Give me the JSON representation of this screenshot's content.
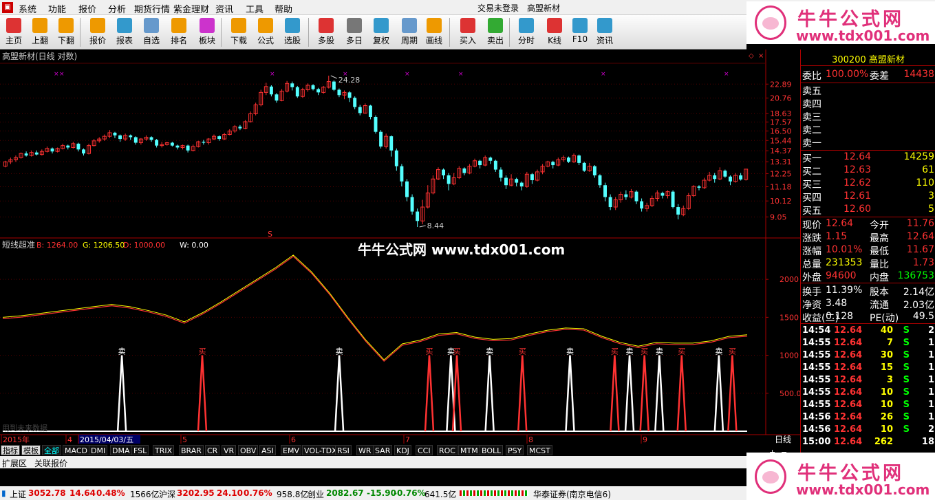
{
  "menubar": {
    "items": [
      "系统",
      "功能",
      "报价",
      "分析",
      "期货行情",
      "紫金理财",
      "资讯",
      "工具",
      "帮助"
    ],
    "center": [
      "交易未登录",
      "高盟新材"
    ]
  },
  "toolbar": [
    {
      "label": "主页",
      "icon": "home-icon",
      "color": "#d33"
    },
    {
      "label": "上翻",
      "icon": "arrow-up-icon",
      "color": "#e90"
    },
    {
      "label": "下翻",
      "icon": "arrow-down-icon",
      "color": "#e90"
    },
    {
      "label": "报价",
      "icon": "yuan-icon",
      "color": "#e90"
    },
    {
      "label": "报表",
      "icon": "report-icon",
      "color": "#39c"
    },
    {
      "label": "自选",
      "icon": "f6-icon",
      "color": "#69c"
    },
    {
      "label": "排名",
      "icon": "rank-icon",
      "color": "#e90"
    },
    {
      "label": "板块",
      "icon": "sector-icon",
      "color": "#c3c"
    },
    {
      "label": "下载",
      "icon": "download-icon",
      "color": "#e90"
    },
    {
      "label": "公式",
      "icon": "formula-icon",
      "color": "#e90"
    },
    {
      "label": "选股",
      "icon": "select-stock-icon",
      "color": "#39c"
    },
    {
      "label": "多股",
      "icon": "multi-stock-icon",
      "color": "#d33"
    },
    {
      "label": "多日",
      "icon": "clock-icon",
      "color": "#777"
    },
    {
      "label": "复权",
      "icon": "restore-icon",
      "color": "#39c"
    },
    {
      "label": "周期",
      "icon": "f8-icon",
      "color": "#69c"
    },
    {
      "label": "画线",
      "icon": "draw-line-icon",
      "color": "#e90"
    },
    {
      "label": "买入",
      "icon": "buy-icon",
      "color": "#d33"
    },
    {
      "label": "卖出",
      "icon": "sell-icon",
      "color": "#3a3"
    },
    {
      "label": "分时",
      "icon": "intraday-icon",
      "color": "#39c"
    },
    {
      "label": "K线",
      "icon": "kline-icon",
      "color": "#d33"
    },
    {
      "label": "F10",
      "icon": "f10-icon",
      "color": "#39c"
    },
    {
      "label": "资讯",
      "icon": "news-icon",
      "color": "#39c"
    }
  ],
  "ad": {
    "title": "牛牛公式网",
    "url": "www.tdx001.com"
  },
  "chart": {
    "title": "高盟新材(日线 对数)",
    "price_ticks": [
      "22.89",
      "20.76",
      "18.63",
      "17.57",
      "16.50",
      "15.44",
      "14.37",
      "13.31",
      "12.25",
      "11.18",
      "10.12",
      "9.05"
    ],
    "high_label": "24.28",
    "low_label": "8.44",
    "s_marker": "S",
    "indicator_name": "短线超准",
    "indicator_values": [
      {
        "label": "B: 1264.00",
        "color": "#ff3232"
      },
      {
        "label": "G: 1206.50",
        "color": "#ffff00"
      },
      {
        "label": "D: 1000.00",
        "color": "#ff3232"
      },
      {
        "label": "W: 0.00",
        "color": "#ffffff"
      }
    ],
    "indicator_ticks": [
      "2000",
      "1500",
      "1000",
      "500.0"
    ],
    "watermark": "牛牛公式网  www.tdx001.com",
    "faded_note": "用到未来数据",
    "buy_label": "买",
    "sell_label": "卖",
    "date_axis": [
      {
        "label": "2015年",
        "highlight": false
      },
      {
        "label": "4",
        "highlight": false
      },
      {
        "label": "2015/04/03/五",
        "highlight": true
      },
      {
        "label": "5",
        "highlight": false
      },
      {
        "label": "6",
        "highlight": false
      },
      {
        "label": "7",
        "highlight": false
      },
      {
        "label": "8",
        "highlight": false
      },
      {
        "label": "9",
        "highlight": false
      }
    ],
    "period_label": "日线"
  },
  "chart_data": {
    "type": "candlestick",
    "ylim": [
      8.44,
      24.28
    ],
    "log_scale": true,
    "candles": [
      [
        12.9,
        13.3,
        13.4,
        12.8
      ],
      [
        13.3,
        13.5,
        13.7,
        13.1
      ],
      [
        13.5,
        13.7,
        13.9,
        13.3
      ],
      [
        13.7,
        14.1,
        14.2,
        13.6
      ],
      [
        14.1,
        13.9,
        14.3,
        13.8
      ],
      [
        13.9,
        14.2,
        14.4,
        13.8
      ],
      [
        14.2,
        14.0,
        14.4,
        13.9
      ],
      [
        14.0,
        14.3,
        14.5,
        13.9
      ],
      [
        14.3,
        14.6,
        14.8,
        14.2
      ],
      [
        14.6,
        14.3,
        14.7,
        14.1
      ],
      [
        14.3,
        14.6,
        14.7,
        14.2
      ],
      [
        14.6,
        14.9,
        15.1,
        14.5
      ],
      [
        14.9,
        14.7,
        15.0,
        14.5
      ],
      [
        14.7,
        15.1,
        15.3,
        14.6
      ],
      [
        15.1,
        14.5,
        15.2,
        14.3
      ],
      [
        14.5,
        14.1,
        14.6,
        13.9
      ],
      [
        14.1,
        14.9,
        15.1,
        14.0
      ],
      [
        14.9,
        15.4,
        15.6,
        14.8
      ],
      [
        15.4,
        15.6,
        15.8,
        15.2
      ],
      [
        15.6,
        15.9,
        16.1,
        15.4
      ],
      [
        15.9,
        16.3,
        16.6,
        15.7
      ],
      [
        16.3,
        16.0,
        16.4,
        15.7
      ],
      [
        16.0,
        15.6,
        16.1,
        15.3
      ],
      [
        15.6,
        16.0,
        16.2,
        15.4
      ],
      [
        16.0,
        15.8,
        16.1,
        15.5
      ],
      [
        15.8,
        15.2,
        15.9,
        15.0
      ],
      [
        15.2,
        15.6,
        15.7,
        15.0
      ],
      [
        15.6,
        15.8,
        16.0,
        15.4
      ],
      [
        15.8,
        15.5,
        15.9,
        15.3
      ],
      [
        15.5,
        14.9,
        15.6,
        14.7
      ],
      [
        14.9,
        15.0,
        15.3,
        14.7
      ],
      [
        15.0,
        15.2,
        15.3,
        14.9
      ],
      [
        15.2,
        14.9,
        15.3,
        14.8
      ],
      [
        14.9,
        14.7,
        15.0,
        14.5
      ],
      [
        14.7,
        14.9,
        15.0,
        14.5
      ],
      [
        14.9,
        14.4,
        15.0,
        14.2
      ],
      [
        14.4,
        14.8,
        15.0,
        14.3
      ],
      [
        14.8,
        15.3,
        15.4,
        14.7
      ],
      [
        15.3,
        15.2,
        15.5,
        15.0
      ],
      [
        15.2,
        15.6,
        15.7,
        15.0
      ],
      [
        15.6,
        15.9,
        16.1,
        15.5
      ],
      [
        15.9,
        15.6,
        16.0,
        15.4
      ],
      [
        15.6,
        16.1,
        16.3,
        15.5
      ],
      [
        16.1,
        16.5,
        16.7,
        16.0
      ],
      [
        16.5,
        17.0,
        17.2,
        16.3
      ],
      [
        17.0,
        16.8,
        17.2,
        16.6
      ],
      [
        16.8,
        17.6,
        17.8,
        16.7
      ],
      [
        17.6,
        18.6,
        18.9,
        17.5
      ],
      [
        18.6,
        19.8,
        20.1,
        18.4
      ],
      [
        19.8,
        21.6,
        22.0,
        19.6
      ],
      [
        21.6,
        22.5,
        23.1,
        21.2
      ],
      [
        22.5,
        21.3,
        22.7,
        21.0
      ],
      [
        21.3,
        20.4,
        21.5,
        20.1
      ],
      [
        20.4,
        21.8,
        22.1,
        20.3
      ],
      [
        21.8,
        23.0,
        23.4,
        21.6
      ],
      [
        23.0,
        22.4,
        23.3,
        21.9
      ],
      [
        22.4,
        21.0,
        22.6,
        20.8
      ],
      [
        21.0,
        22.0,
        22.3,
        20.8
      ],
      [
        22.0,
        22.7,
        23.0,
        21.7
      ],
      [
        22.7,
        22.1,
        22.9,
        21.9
      ],
      [
        22.1,
        21.6,
        22.3,
        21.2
      ],
      [
        21.6,
        22.4,
        22.6,
        21.4
      ],
      [
        22.4,
        23.3,
        24.28,
        22.2
      ],
      [
        23.3,
        22.0,
        23.5,
        21.8
      ],
      [
        22.0,
        21.2,
        22.2,
        20.9
      ],
      [
        21.2,
        21.6,
        21.9,
        20.6
      ],
      [
        21.6,
        20.8,
        21.8,
        20.2
      ],
      [
        20.8,
        19.5,
        21.0,
        19.2
      ],
      [
        19.5,
        18.7,
        19.8,
        18.4
      ],
      [
        18.7,
        19.7,
        20.0,
        18.6
      ],
      [
        19.7,
        18.2,
        19.8,
        17.9
      ],
      [
        18.2,
        16.4,
        18.4,
        16.2
      ],
      [
        16.4,
        14.8,
        16.6,
        14.6
      ],
      [
        14.8,
        15.9,
        16.2,
        14.6
      ],
      [
        15.9,
        14.4,
        16.0,
        13.8
      ],
      [
        14.4,
        12.9,
        14.6,
        12.5
      ],
      [
        12.9,
        11.6,
        13.1,
        11.2
      ],
      [
        11.6,
        10.4,
        11.8,
        10.1
      ],
      [
        10.4,
        9.4,
        10.6,
        9.2
      ],
      [
        9.4,
        8.8,
        9.6,
        8.44
      ],
      [
        8.8,
        9.7,
        10.2,
        8.6
      ],
      [
        9.7,
        10.7,
        11.3,
        9.6
      ],
      [
        10.7,
        11.8,
        12.1,
        10.6
      ],
      [
        11.8,
        12.6,
        12.8,
        11.7
      ],
      [
        12.6,
        12.1,
        12.7,
        11.8
      ],
      [
        12.1,
        11.4,
        12.3,
        10.9
      ],
      [
        11.4,
        11.9,
        12.3,
        11.3
      ],
      [
        11.9,
        12.7,
        12.9,
        11.8
      ],
      [
        12.7,
        12.3,
        12.8,
        12.1
      ],
      [
        12.3,
        12.9,
        13.1,
        12.2
      ],
      [
        12.9,
        13.4,
        13.6,
        12.8
      ],
      [
        13.4,
        13.0,
        13.5,
        12.7
      ],
      [
        13.0,
        13.7,
        13.9,
        12.9
      ],
      [
        13.7,
        13.4,
        13.8,
        13.1
      ],
      [
        13.4,
        12.6,
        13.5,
        12.4
      ],
      [
        12.6,
        11.9,
        12.8,
        11.6
      ],
      [
        11.9,
        11.3,
        12.1,
        11.0
      ],
      [
        11.3,
        11.8,
        12.2,
        11.2
      ],
      [
        11.8,
        11.5,
        11.9,
        11.2
      ],
      [
        11.5,
        11.2,
        11.6,
        10.9
      ],
      [
        11.2,
        12.2,
        12.4,
        11.1
      ],
      [
        12.2,
        11.7,
        12.3,
        11.4
      ],
      [
        11.7,
        12.4,
        12.6,
        11.6
      ],
      [
        12.4,
        12.9,
        13.1,
        12.2
      ],
      [
        12.9,
        13.3,
        13.4,
        12.8
      ],
      [
        13.3,
        13.0,
        13.4,
        12.7
      ],
      [
        13.0,
        13.5,
        13.7,
        12.9
      ],
      [
        13.5,
        13.7,
        13.9,
        13.3
      ],
      [
        13.7,
        13.3,
        13.8,
        13.2
      ],
      [
        13.3,
        13.9,
        14.1,
        13.2
      ],
      [
        13.9,
        13.2,
        14.0,
        13.0
      ],
      [
        13.2,
        12.5,
        13.3,
        12.4
      ],
      [
        12.5,
        12.9,
        13.2,
        12.4
      ],
      [
        12.9,
        12.1,
        13.0,
        11.9
      ],
      [
        12.1,
        11.3,
        12.2,
        11.1
      ],
      [
        11.3,
        10.4,
        11.5,
        10.1
      ],
      [
        10.4,
        9.7,
        10.6,
        9.5
      ],
      [
        9.7,
        10.2,
        10.4,
        9.5
      ],
      [
        10.2,
        10.6,
        10.8,
        10.0
      ],
      [
        10.6,
        10.4,
        10.9,
        10.2
      ],
      [
        10.4,
        10.8,
        11.0,
        10.3
      ],
      [
        10.8,
        10.1,
        10.9,
        9.9
      ],
      [
        10.1,
        9.6,
        10.3,
        9.4
      ],
      [
        9.6,
        9.8,
        10.0,
        9.4
      ],
      [
        9.8,
        10.3,
        10.5,
        9.7
      ],
      [
        10.3,
        10.7,
        10.9,
        10.1
      ],
      [
        10.7,
        10.5,
        10.8,
        10.3
      ],
      [
        10.5,
        10.8,
        10.9,
        10.3
      ],
      [
        10.8,
        9.7,
        10.9,
        9.6
      ],
      [
        9.7,
        9.2,
        9.9,
        8.9
      ],
      [
        9.2,
        9.6,
        9.8,
        9.1
      ],
      [
        9.6,
        10.5,
        10.7,
        9.5
      ],
      [
        10.5,
        11.2,
        11.3,
        10.4
      ],
      [
        11.2,
        11.1,
        11.3,
        10.9
      ],
      [
        11.1,
        11.7,
        11.9,
        11.0
      ],
      [
        11.7,
        12.1,
        12.4,
        11.6
      ],
      [
        12.1,
        11.8,
        12.3,
        11.5
      ],
      [
        11.8,
        12.5,
        12.8,
        11.7
      ],
      [
        12.5,
        12.0,
        12.6,
        11.9
      ],
      [
        12.0,
        11.6,
        12.1,
        11.3
      ],
      [
        11.6,
        12.1,
        12.3,
        11.5
      ],
      [
        12.1,
        11.76,
        12.3,
        11.67
      ],
      [
        11.76,
        12.64,
        12.64,
        11.67
      ]
    ],
    "indicator_line": {
      "name": "G",
      "values": [
        1500,
        1520,
        1550,
        1580,
        1610,
        1640,
        1670,
        1640,
        1590,
        1530,
        1440,
        1560,
        1700,
        1850,
        2000,
        2150,
        2320,
        2100,
        1820,
        1500,
        1200,
        940,
        1150,
        1200,
        1280,
        1300,
        1240,
        1210,
        1220,
        1280,
        1330,
        1360,
        1350,
        1250,
        1170,
        1120,
        1170,
        1160,
        1160,
        1190,
        1250,
        1270
      ]
    },
    "signals": [
      {
        "type": "sell",
        "label": "卖",
        "x": 0.16
      },
      {
        "type": "buy",
        "label": "买",
        "x": 0.268
      },
      {
        "type": "sell",
        "label": "卖",
        "x": 0.452
      },
      {
        "type": "buy",
        "label": "买",
        "x": 0.573
      },
      {
        "type": "sell",
        "label": "卖",
        "x": 0.602
      },
      {
        "type": "buy",
        "label": "买",
        "x": 0.61
      },
      {
        "type": "sell",
        "label": "卖",
        "x": 0.654
      },
      {
        "type": "buy",
        "label": "买",
        "x": 0.698
      },
      {
        "type": "sell",
        "label": "卖",
        "x": 0.762
      },
      {
        "type": "buy",
        "label": "买",
        "x": 0.822
      },
      {
        "type": "sell",
        "label": "卖",
        "x": 0.842
      },
      {
        "type": "buy",
        "label": "买",
        "x": 0.862
      },
      {
        "type": "sell",
        "label": "卖",
        "x": 0.882
      },
      {
        "type": "buy",
        "label": "买",
        "x": 0.912
      },
      {
        "type": "sell",
        "label": "卖",
        "x": 0.962
      },
      {
        "type": "buy",
        "label": "买",
        "x": 0.98
      }
    ],
    "indicator_ylim": [
      0,
      2400
    ]
  },
  "quote": {
    "header": "300200 高盟新材",
    "weibi": {
      "label": "委比",
      "value": "100.00%",
      "label2": "委差",
      "value2": "14438"
    },
    "sell_levels": [
      "卖五",
      "卖四",
      "卖三",
      "卖二",
      "卖一"
    ],
    "buy_levels": [
      {
        "label": "买一",
        "price": "12.64",
        "vol": "14259"
      },
      {
        "label": "买二",
        "price": "12.63",
        "vol": "61"
      },
      {
        "label": "买三",
        "price": "12.62",
        "vol": "110"
      },
      {
        "label": "买四",
        "price": "12.61",
        "vol": "3"
      },
      {
        "label": "买五",
        "price": "12.60",
        "vol": "5"
      }
    ],
    "stats": [
      {
        "l1": "现价",
        "v1": "12.64",
        "c1": "#ff3232",
        "l2": "今开",
        "v2": "11.76",
        "c2": "#ff3232"
      },
      {
        "l1": "涨跌",
        "v1": "1.15",
        "c1": "#ff3232",
        "l2": "最高",
        "v2": "12.64",
        "c2": "#ff3232"
      },
      {
        "l1": "涨幅",
        "v1": "10.01%",
        "c1": "#ff3232",
        "l2": "最低",
        "v2": "11.67",
        "c2": "#ff3232"
      },
      {
        "l1": "总量",
        "v1": "231353",
        "c1": "#ffff00",
        "l2": "量比",
        "v2": "1.73",
        "c2": "#ff3232"
      },
      {
        "l1": "外盘",
        "v1": "94600",
        "c1": "#ff3232",
        "l2": "内盘",
        "v2": "136753",
        "c2": "#00ff00"
      }
    ],
    "stats2": [
      {
        "l1": "换手",
        "v1": "11.39%",
        "l2": "股本",
        "v2": "2.14亿"
      },
      {
        "l1": "净资",
        "v1": "3.48",
        "l2": "流通",
        "v2": "2.03亿"
      },
      {
        "l1": "收益(二)",
        "v1": "0.128",
        "l2": "PE(动)",
        "v2": "49.5"
      }
    ],
    "ticks": [
      {
        "time": "14:54",
        "price": "12.64",
        "vol": "40",
        "bs": "S",
        "n": "2"
      },
      {
        "time": "14:55",
        "price": "12.64",
        "vol": "7",
        "bs": "S",
        "n": "1"
      },
      {
        "time": "14:55",
        "price": "12.64",
        "vol": "30",
        "bs": "S",
        "n": "1"
      },
      {
        "time": "14:55",
        "price": "12.64",
        "vol": "15",
        "bs": "S",
        "n": "1"
      },
      {
        "time": "14:55",
        "price": "12.64",
        "vol": "3",
        "bs": "S",
        "n": "1"
      },
      {
        "time": "14:55",
        "price": "12.64",
        "vol": "10",
        "bs": "S",
        "n": "1"
      },
      {
        "time": "14:55",
        "price": "12.64",
        "vol": "10",
        "bs": "S",
        "n": "1"
      },
      {
        "time": "14:56",
        "price": "12.64",
        "vol": "26",
        "bs": "S",
        "n": "1"
      },
      {
        "time": "14:56",
        "price": "12.64",
        "vol": "10",
        "bs": "S",
        "n": "2"
      },
      {
        "time": "15:00",
        "price": "12.64",
        "vol": "262",
        "bs": "",
        "n": "18"
      }
    ]
  },
  "indicator_tabs": [
    "指标",
    "模板",
    "全部",
    "MACD",
    "DMI",
    "DMA",
    "FSL",
    "TRIX",
    "BRAR",
    "CR",
    "VR",
    "OBV",
    "ASI",
    "EMV",
    "VOL-TDX",
    "RSI",
    "WR",
    "SAR",
    "KDJ",
    "CCI",
    "ROC",
    "MTM",
    "BOLL",
    "PSY",
    "MCST"
  ],
  "ext_bar": [
    "扩展区",
    "关联报价"
  ],
  "status": {
    "sh_label": "上证",
    "sh_value": "3052.78",
    "sh_change": "14.64",
    "sh_pct": "0.48%",
    "sh_amount": "1566亿",
    "sz_label": "沪深",
    "sz_value": "3202.95",
    "sz_change": "24.10",
    "sz_pct": "0.76%",
    "sz_amount": "958.8亿",
    "cy_label": "创业",
    "cy_value": "2082.67",
    "cy_change": "-15.90",
    "cy_pct": "-0.76%",
    "cy_amount": "641.5亿",
    "broker": "华泰证券(南京电信6)"
  }
}
